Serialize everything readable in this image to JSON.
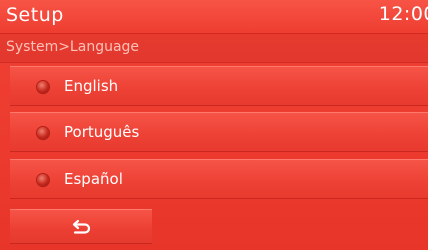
{
  "header": {
    "title": "Setup",
    "clock": "12:00"
  },
  "breadcrumb": "System>Language",
  "languages": [
    {
      "label": "English"
    },
    {
      "label": "Português"
    },
    {
      "label": "Español"
    }
  ],
  "back_button": {
    "icon": "back-arrow-icon"
  },
  "colors": {
    "background": "#ec3a2e",
    "text": "#ffffff",
    "breadcrumb_text": "#ffc2b8"
  }
}
